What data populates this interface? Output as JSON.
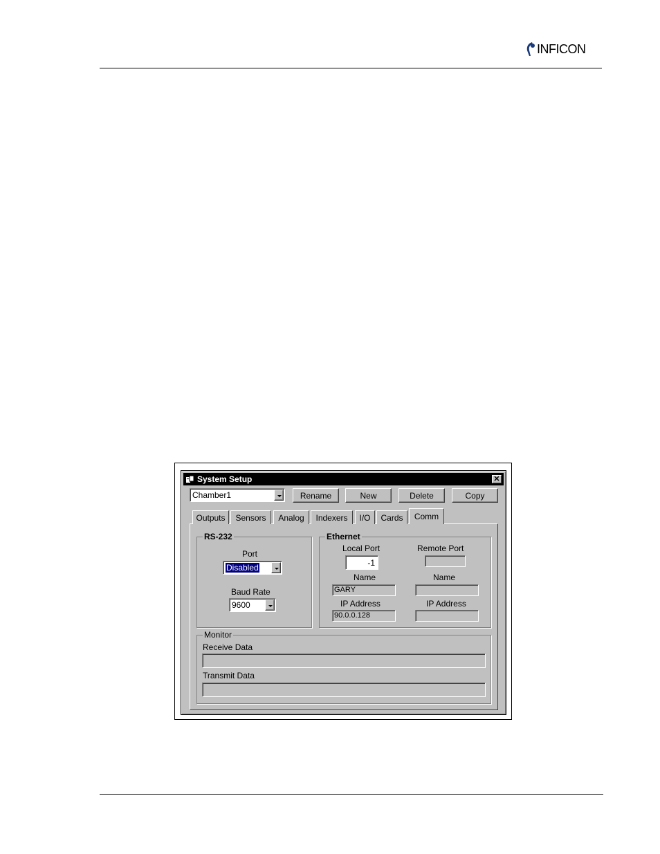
{
  "header": {
    "brand": "INFICON"
  },
  "window": {
    "title": "System Setup",
    "close_label": "✕",
    "chamber_value": "Chamber1",
    "buttons": {
      "rename": "Rename",
      "new": "New",
      "delete": "Delete",
      "copy": "Copy"
    }
  },
  "tabs": [
    "Outputs",
    "Sensors",
    "Analog",
    "Indexers",
    "I/O",
    "Cards",
    "Comm"
  ],
  "active_tab": "Comm",
  "rs232": {
    "title": "RS-232",
    "port_label": "Port",
    "port_value": "Disabled",
    "baud_label": "Baud Rate",
    "baud_value": "9600"
  },
  "ethernet": {
    "title": "Ethernet",
    "local_port_label": "Local Port",
    "local_port_value": "-1",
    "remote_port_label": "Remote Port",
    "remote_port_value": "",
    "local_name_label": "Name",
    "local_name_value": "GARY",
    "remote_name_label": "Name",
    "remote_name_value": "",
    "local_ip_label": "IP Address",
    "local_ip_value": "90.0.0.128",
    "remote_ip_label": "IP Address",
    "remote_ip_value": ""
  },
  "monitor": {
    "title": "Monitor",
    "receive_label": "Receive Data",
    "receive_value": "",
    "transmit_label": "Transmit Data",
    "transmit_value": ""
  }
}
